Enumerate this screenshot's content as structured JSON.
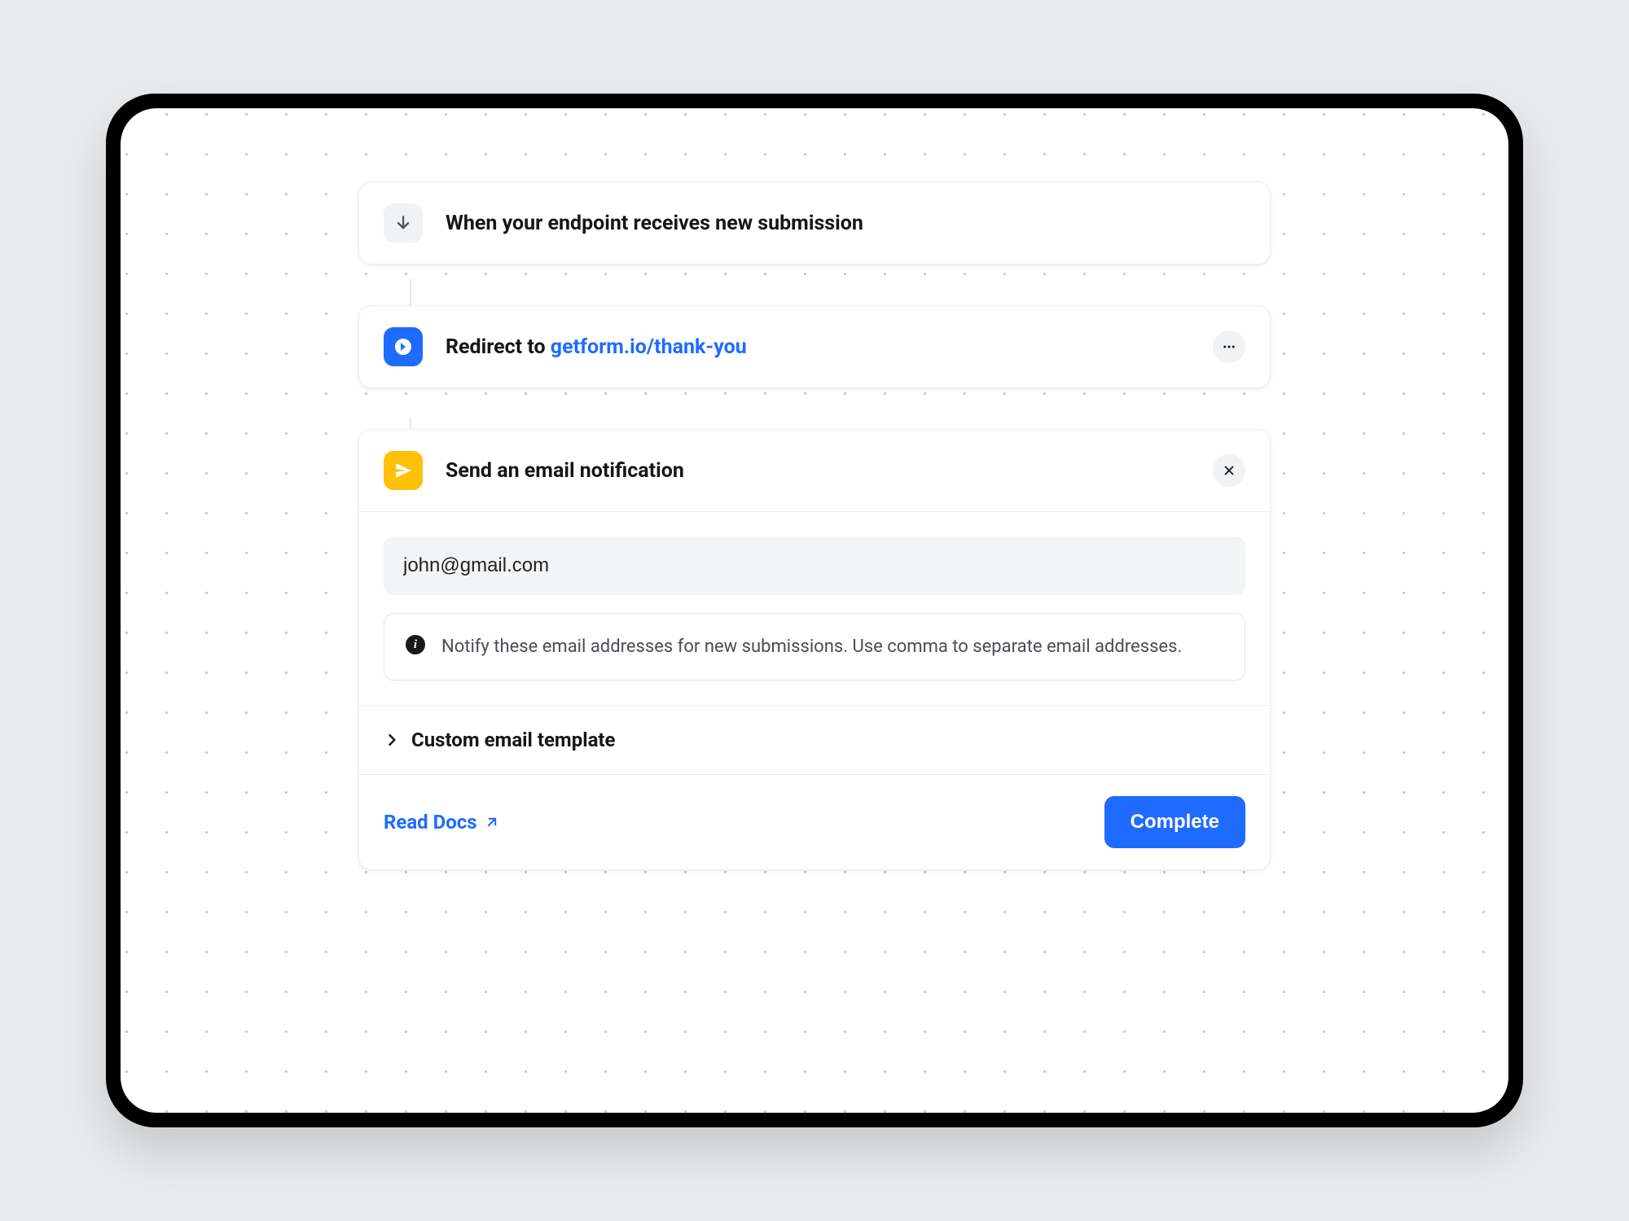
{
  "steps": {
    "trigger": {
      "title": "When your endpoint receives new submission"
    },
    "redirect": {
      "prefix": "Redirect to ",
      "url": "getform.io/thank-you"
    },
    "email": {
      "title": "Send an email notification",
      "input_value": "john@gmail.com",
      "help_text": "Notify these email addresses for new submissions. Use comma to separate email addresses.",
      "template_label": "Custom email template",
      "docs_label": "Read Docs",
      "complete_label": "Complete"
    }
  }
}
